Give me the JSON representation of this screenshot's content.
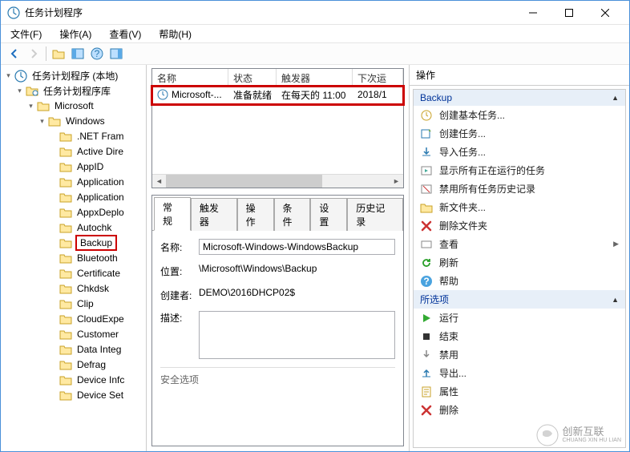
{
  "window": {
    "title": "任务计划程序",
    "icon": "clock"
  },
  "menu": {
    "file": "文件(F)",
    "action": "操作(A)",
    "view": "查看(V)",
    "help": "帮助(H)"
  },
  "tree": {
    "root": "任务计划程序 (本地)",
    "library": "任务计划程序库",
    "microsoft": "Microsoft",
    "windows": "Windows",
    "items": [
      ".NET Fram",
      "Active Dire",
      "AppID",
      "Application",
      "Application",
      "AppxDeplo",
      "Autochk",
      "Backup",
      "Bluetooth",
      "Certificate",
      "Chkdsk",
      "Clip",
      "CloudExpe",
      "Customer",
      "Data Integ",
      "Defrag",
      "Device Infc",
      "Device Set"
    ],
    "selected_index": 7
  },
  "tasklist": {
    "cols": {
      "name": "名称",
      "status": "状态",
      "trigger": "触发器",
      "next": "下次运"
    },
    "row": {
      "name": "Microsoft-...",
      "status": "准备就绪",
      "trigger": "在每天的 11:00",
      "next": "2018/1"
    }
  },
  "details": {
    "tabs": {
      "general": "常规",
      "triggers": "触发器",
      "actions": "操作",
      "conditions": "条件",
      "settings": "设置",
      "history": "历史记录"
    },
    "labels": {
      "name": "名称:",
      "location": "位置:",
      "creator": "创建者:",
      "description": "描述:",
      "security": "安全选项"
    },
    "values": {
      "name": "Microsoft-Windows-WindowsBackup",
      "location": "\\Microsoft\\Windows\\Backup",
      "creator": "DEMO\\2016DHCP02$"
    }
  },
  "actions": {
    "pane_title": "操作",
    "section1": "Backup",
    "items1": [
      {
        "icon": "clock-wizard",
        "label": "创建基本任务..."
      },
      {
        "icon": "new-task",
        "label": "创建任务..."
      },
      {
        "icon": "import",
        "label": "导入任务..."
      },
      {
        "icon": "running",
        "label": "显示所有正在运行的任务"
      },
      {
        "icon": "history-off",
        "label": "禁用所有任务历史记录"
      },
      {
        "icon": "new-folder",
        "label": "新文件夹..."
      },
      {
        "icon": "delete-x",
        "label": "删除文件夹"
      },
      {
        "icon": "view",
        "label": "查看",
        "sub": true
      },
      {
        "icon": "refresh",
        "label": "刷新"
      },
      {
        "icon": "help",
        "label": "帮助"
      }
    ],
    "section2": "所选项",
    "items2": [
      {
        "icon": "play",
        "label": "运行"
      },
      {
        "icon": "stop",
        "label": "结束"
      },
      {
        "icon": "disable",
        "label": "禁用"
      },
      {
        "icon": "export",
        "label": "导出..."
      },
      {
        "icon": "props",
        "label": "属性"
      },
      {
        "icon": "delete-x",
        "label": "删除"
      }
    ]
  },
  "watermark": {
    "brand": "创新互联",
    "sub": "CHUANG XIN HU LIAN"
  }
}
